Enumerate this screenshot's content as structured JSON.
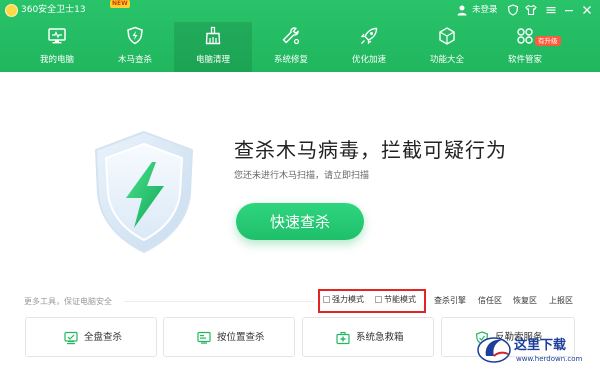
{
  "titlebar": {
    "app_title": "360安全卫士13",
    "new_badge": "NEW",
    "login_label": "未登录",
    "icons": [
      "user-icon",
      "shield-outline-icon",
      "skin-icon",
      "menu-icon",
      "minimize-icon",
      "close-icon"
    ]
  },
  "nav": {
    "items": [
      {
        "label": "我的电脑",
        "icon": "monitor-icon"
      },
      {
        "label": "木马查杀",
        "icon": "shield-bolt-icon"
      },
      {
        "label": "电脑清理",
        "icon": "broom-icon",
        "active": true
      },
      {
        "label": "系统修复",
        "icon": "wrench-icon"
      },
      {
        "label": "优化加速",
        "icon": "rocket-icon"
      },
      {
        "label": "功能大全",
        "icon": "apps-icon"
      },
      {
        "label": "软件管家",
        "icon": "software-icon",
        "badge": "有升级"
      }
    ]
  },
  "hero": {
    "title": "查杀木马病毒，拦截可疑行为",
    "subtitle": "您还未进行木马扫描，请立即扫描",
    "scan_button": "快速查杀"
  },
  "options": {
    "more_tools": "更多工具，保证电脑安全",
    "mode_strong": "强力模式",
    "mode_saving": "节能模式",
    "links": [
      "查杀引擎",
      "信任区",
      "恢复区",
      "上报区"
    ]
  },
  "tools": [
    {
      "label": "全盘查杀",
      "icon": "full-scan-icon"
    },
    {
      "label": "按位置查杀",
      "icon": "location-scan-icon"
    },
    {
      "label": "系统急救箱",
      "icon": "first-aid-icon"
    },
    {
      "label": "反勒索服务",
      "icon": "anti-ransom-icon"
    }
  ],
  "watermark": {
    "text": "这里下载",
    "url": "www.herdown.com"
  },
  "colors": {
    "brand_green": "#22b862",
    "button_green": "#25c973",
    "highlight_red": "#e32424",
    "watermark_blue": "#1b3f9a"
  }
}
